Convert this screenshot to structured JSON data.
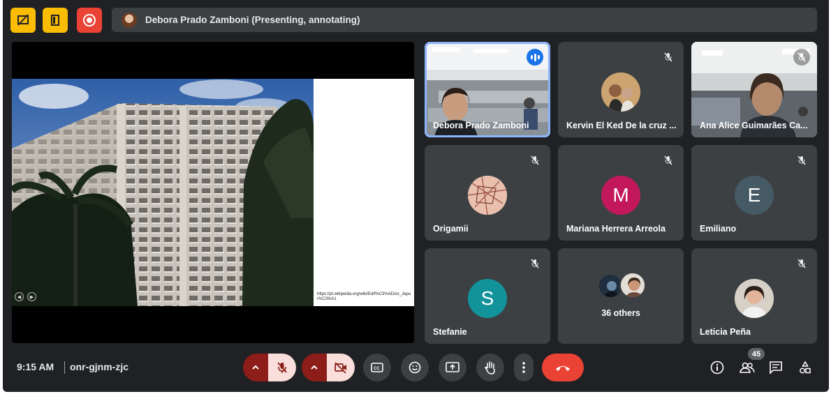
{
  "topbar": {
    "presenter_name": "Debora Prado Zamboni (Presenting, annotating)",
    "buttons": [
      {
        "icon": "hide-annotations-icon",
        "color": "#fbbc04"
      },
      {
        "icon": "exit-door-icon",
        "color": "#fbbc04"
      },
      {
        "icon": "record-icon",
        "color": "#ea4335"
      }
    ]
  },
  "presentation": {
    "caption": "https://pt.wikipedia.org/wiki/Edif%C3%ADcio_Japur%C3%A1"
  },
  "participants": [
    {
      "name": "Debora Prado Zamboni",
      "type": "video",
      "state": "speaking"
    },
    {
      "name": "Kervin El Ked De la cruz ...",
      "type": "photo",
      "state": "muted"
    },
    {
      "name": "Ana Alice Guimarães Ca...",
      "type": "video",
      "state": "muted"
    },
    {
      "name": "Origamii",
      "type": "photo",
      "state": "muted"
    },
    {
      "name": "Mariana Herrera Arreola",
      "initial": "M",
      "avatar_color": "#c2185b",
      "state": "muted"
    },
    {
      "name": "Emiliano",
      "initial": "E",
      "avatar_color": "#455a64",
      "state": "muted"
    },
    {
      "name": "Stefanie",
      "initial": "S",
      "avatar_color": "#12939a",
      "state": "muted"
    },
    {
      "name": "36 others",
      "type": "group"
    },
    {
      "name": "Leticia Peña",
      "type": "photo",
      "state": "muted"
    }
  ],
  "bottombar": {
    "time": "9:15 AM",
    "meeting_code": "onr-gjnm-zjc",
    "participant_count": "45",
    "controls": [
      "mic-options-caret-icon",
      "mic-off-icon",
      "camera-options-caret-icon",
      "camera-off-icon",
      "captions-icon",
      "emoji-reaction-icon",
      "present-screen-icon",
      "raise-hand-icon",
      "more-options-icon",
      "end-call-icon"
    ],
    "right_icons": [
      "meeting-details-icon",
      "people-icon",
      "chat-icon",
      "activities-icon"
    ]
  }
}
